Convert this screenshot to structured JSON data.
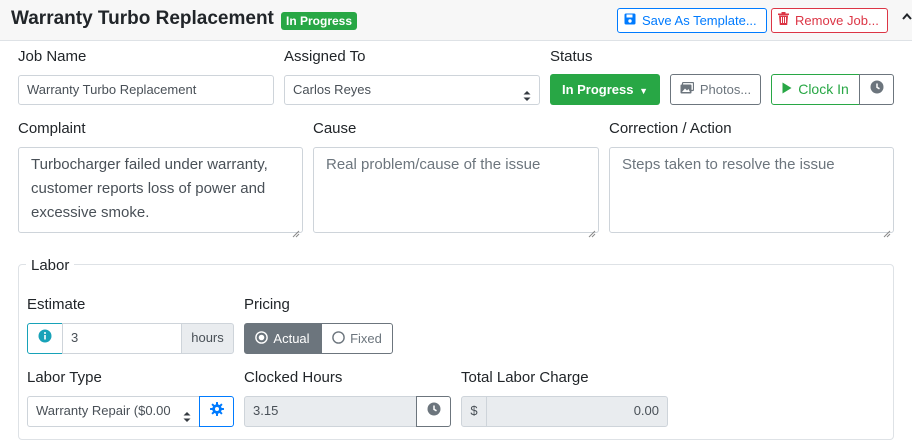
{
  "header": {
    "title": "Warranty Turbo Replacement",
    "status_badge": "In Progress",
    "save_template_label": "Save As Template...",
    "remove_job_label": "Remove Job..."
  },
  "fields": {
    "job_name": {
      "label": "Job Name",
      "value": "Warranty Turbo Replacement"
    },
    "assigned_to": {
      "label": "Assigned To",
      "value": "Carlos Reyes"
    },
    "status": {
      "label": "Status",
      "value": "In Progress"
    },
    "photos_label": "Photos...",
    "clock_in_label": "Clock In"
  },
  "complaint": {
    "label": "Complaint",
    "value": "Turbocharger failed under warranty, customer reports loss of power and excessive smoke."
  },
  "cause": {
    "label": "Cause",
    "placeholder": "Real problem/cause of the issue"
  },
  "correction": {
    "label": "Correction / Action",
    "placeholder": "Steps taken to resolve the issue"
  },
  "labor": {
    "legend": "Labor",
    "estimate": {
      "label": "Estimate",
      "value": "3",
      "unit": "hours"
    },
    "pricing": {
      "label": "Pricing",
      "options": [
        "Actual",
        "Fixed"
      ],
      "selected": "Actual"
    },
    "labor_type": {
      "label": "Labor Type",
      "value": "Warranty Repair ($0.00"
    },
    "clocked_hours": {
      "label": "Clocked Hours",
      "value": "3.15"
    },
    "total_labor_charge": {
      "label": "Total Labor Charge",
      "currency": "$",
      "value": "0.00"
    }
  },
  "colors": {
    "success": "#28a745",
    "primary": "#007bff",
    "danger": "#dc3545",
    "info": "#17a2b8",
    "secondary": "#6c757d"
  }
}
